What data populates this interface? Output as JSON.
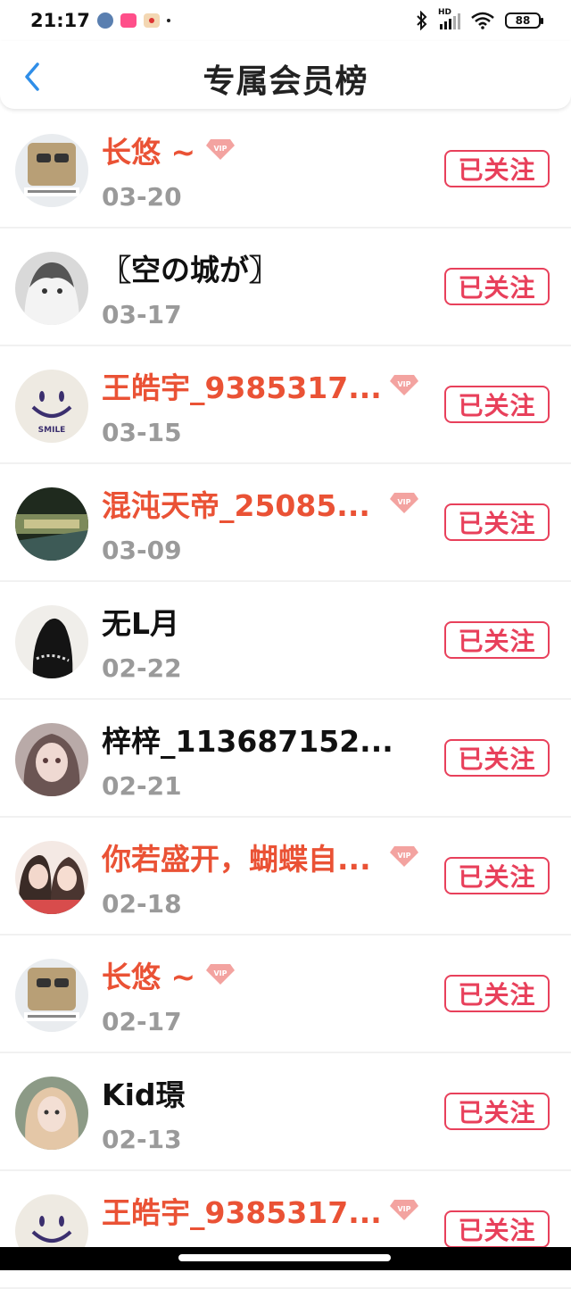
{
  "status_bar": {
    "time": "21:17",
    "battery": "88",
    "network": "HD"
  },
  "header": {
    "title": "专属会员榜",
    "back_icon": "chevron-left-icon"
  },
  "colors": {
    "vip_name": "#ea5235",
    "follow_red": "#e8405b",
    "date_gray": "#9a9a9a",
    "back_blue": "#2f8ee8"
  },
  "members": [
    {
      "name": "长悠 ~",
      "date": "03-20",
      "vip": true,
      "follow_label": "已关注"
    },
    {
      "name": "〖空の城が〗",
      "date": "03-17",
      "vip": false,
      "follow_label": "已关注"
    },
    {
      "name": "王皓宇_9385317...",
      "date": "03-15",
      "vip": true,
      "follow_label": "已关注"
    },
    {
      "name": "混沌天帝_25085...",
      "date": "03-09",
      "vip": true,
      "follow_label": "已关注"
    },
    {
      "name": "无L月",
      "date": "02-22",
      "vip": false,
      "follow_label": "已关注"
    },
    {
      "name": "梓梓_113687152...",
      "date": "02-21",
      "vip": false,
      "follow_label": "已关注"
    },
    {
      "name": "你若盛开，蝴蝶自...",
      "date": "02-18",
      "vip": true,
      "follow_label": "已关注"
    },
    {
      "name": "长悠 ~",
      "date": "02-17",
      "vip": true,
      "follow_label": "已关注"
    },
    {
      "name": "Kid璟",
      "date": "02-13",
      "vip": false,
      "follow_label": "已关注"
    },
    {
      "name": "王皓宇_9385317...",
      "date": "",
      "vip": true,
      "follow_label": "已关注"
    }
  ]
}
